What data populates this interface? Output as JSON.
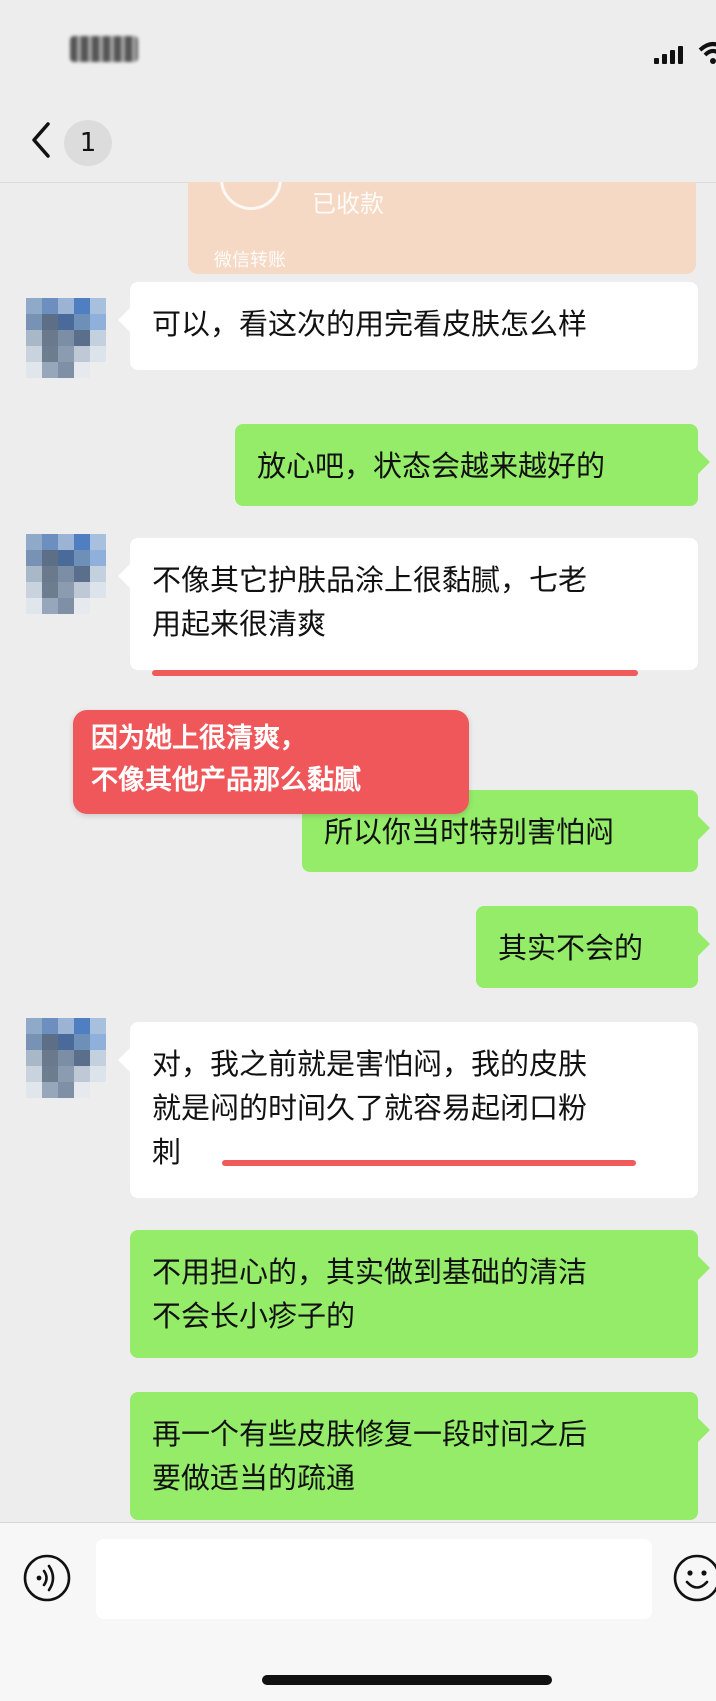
{
  "status_bar": {
    "time": ""
  },
  "header": {
    "unread_count": "1",
    "title": ""
  },
  "transfer_card": {
    "status": "已收款",
    "label": "微信转账"
  },
  "messages": [
    {
      "from": "contact",
      "lines": [
        "可以，看这次的用完看皮肤怎么样"
      ]
    },
    {
      "from": "me",
      "lines": [
        "放心吧，状态会越来越好的"
      ]
    },
    {
      "from": "contact",
      "lines": [
        "不像其它护肤品涂上很黏腻，七老",
        "用起来很清爽"
      ]
    },
    {
      "from": "me",
      "lines": [
        "所以你当时特别害怕闷"
      ]
    },
    {
      "from": "me",
      "lines": [
        "其实不会的"
      ]
    },
    {
      "from": "contact",
      "lines": [
        "对，我之前就是害怕闷，我的皮肤",
        "就是闷的时间久了就容易起闭口粉",
        "刺"
      ]
    },
    {
      "from": "me",
      "lines": [
        "不用担心的，其实做到基础的清洁",
        "不会长小疹子的"
      ]
    },
    {
      "from": "me",
      "lines": [
        "再一个有些皮肤修复一段时间之后",
        "要做适当的疏通"
      ]
    }
  ],
  "annotation": {
    "lines": [
      "因为她上很清爽，",
      "不像其他产品那么黏腻"
    ]
  },
  "input_bar": {
    "placeholder": ""
  },
  "colors": {
    "outgoing_bubble": "#95ec69",
    "incoming_bubble": "#ffffff",
    "highlight": "#f05a5a",
    "background": "#ededed"
  }
}
